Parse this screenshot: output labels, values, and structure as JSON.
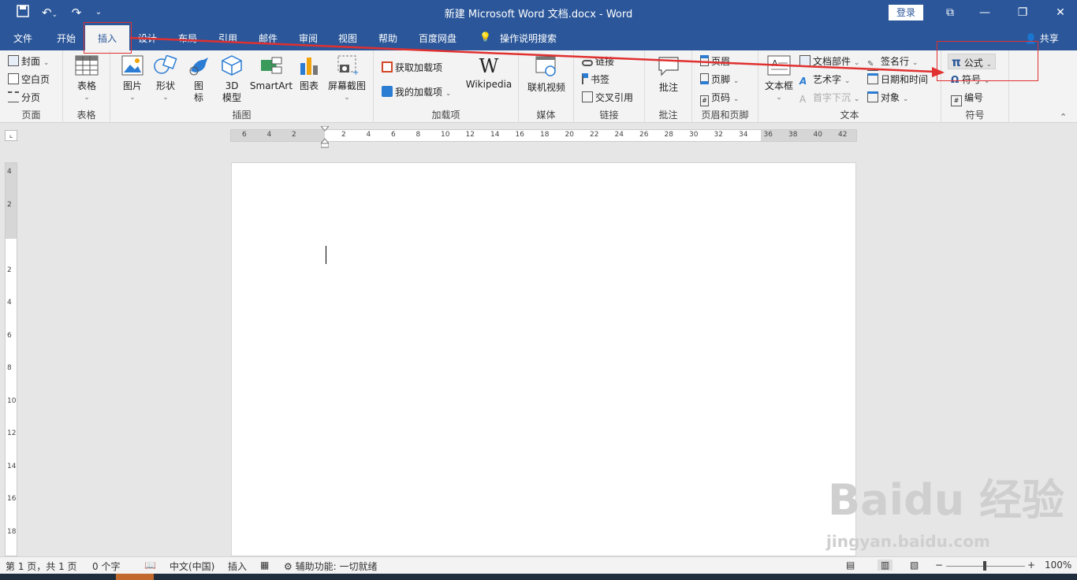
{
  "titlebar": {
    "title": "新建 Microsoft Word 文档.docx  -  Word",
    "signin": "登录"
  },
  "tabs": [
    "文件",
    "开始",
    "插入",
    "设计",
    "布局",
    "引用",
    "邮件",
    "审阅",
    "视图",
    "帮助",
    "百度网盘",
    "操作说明搜索"
  ],
  "share": "共享",
  "ribbon": {
    "pages": {
      "label": "页面",
      "cover": "封面",
      "blank": "空白页",
      "break": "分页"
    },
    "tables": {
      "label": "表格",
      "table": "表格"
    },
    "illustrations": {
      "label": "插图",
      "picture": "图片",
      "shapes": "形状",
      "icons": "图\n标",
      "model3d": "3D\n模型",
      "smartart": "SmartArt",
      "chart": "图表",
      "screenshot": "屏幕截图"
    },
    "addins": {
      "label": "加载项",
      "get": "获取加载项",
      "my": "我的加载项",
      "wiki": "Wikipedia"
    },
    "media": {
      "label": "媒体",
      "video": "联机视频"
    },
    "links": {
      "label": "链接",
      "link": "链接",
      "bookmark": "书签",
      "crossref": "交叉引用"
    },
    "comments": {
      "label": "批注",
      "comment": "批注"
    },
    "hf": {
      "label": "页眉和页脚",
      "header": "页眉",
      "footer": "页脚",
      "pagenum": "页码"
    },
    "text": {
      "label": "文本",
      "textbox": "文本框",
      "quickparts": "文档部件",
      "wordart": "艺术字",
      "dropcap": "首字下沉",
      "signature": "签名行",
      "datetime": "日期和时间",
      "object": "对象"
    },
    "symbols": {
      "label": "符号",
      "equation": "公式",
      "symbol": "符号",
      "number": "编号"
    }
  },
  "ruler_h": [
    "6",
    "4",
    "2",
    "",
    "2",
    "4",
    "6",
    "8",
    "10",
    "12",
    "14",
    "16",
    "18",
    "20",
    "22",
    "24",
    "26",
    "28",
    "30",
    "32",
    "34",
    "36",
    "38",
    "40",
    "42"
  ],
  "ruler_v": [
    "4",
    "2",
    "",
    "2",
    "4",
    "6",
    "8",
    "10",
    "12",
    "14",
    "16",
    "18"
  ],
  "status": {
    "page": "第 1 页，共 1 页",
    "words": "0 个字",
    "lang": "中文(中国)",
    "mode": "插入",
    "access": "辅助功能: 一切就绪",
    "zoom": "100%"
  },
  "watermark": {
    "brand": "Baidu 经验",
    "url": "jingyan.baidu.com"
  }
}
